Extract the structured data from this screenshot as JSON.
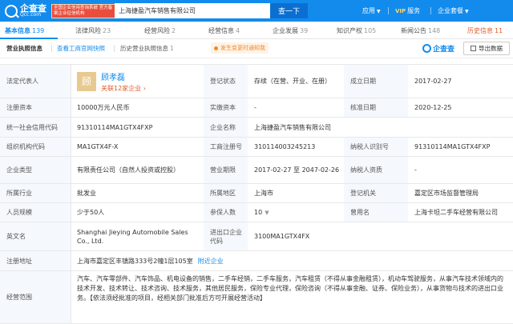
{
  "header": {
    "logo_cn": "企查查",
    "logo_en": "Qcc.com",
    "auth_badge": "全国企业信用查询系统 官方备案企业征信机构",
    "search_value": "上海捷盈汽车销售有限公司",
    "search_button": "查一下",
    "nav_app": "应用",
    "nav_vip_tag": "VIP",
    "nav_vip": "服务",
    "nav_group": "企业套餐"
  },
  "tabs": [
    {
      "label": "基本信息",
      "num": "139"
    },
    {
      "label": "法律风险",
      "num": "23"
    },
    {
      "label": "经营风险",
      "num": "2"
    },
    {
      "label": "经营信息",
      "num": "4"
    },
    {
      "label": "企业发展",
      "num": "39"
    },
    {
      "label": "知识产权",
      "num": "105"
    },
    {
      "label": "新闻公告",
      "num": "148"
    },
    {
      "label": "历史信息",
      "num": "11"
    }
  ],
  "subtabs": {
    "license": "营业执照信息",
    "official": "查看工商官网快照",
    "history": "历史营业执照信息",
    "history_num": "1",
    "change_tag": "发生变更时通知我",
    "brand": "企查查",
    "export": "导出数据"
  },
  "info": {
    "legal_rep_label": "法定代表人",
    "legal_rep_avatar": "顾",
    "legal_rep_name": "顾孝磊",
    "legal_rep_assoc": "关联12家企业 ›",
    "reg_status_label": "登记状态",
    "reg_status": "存续（在营、开业、在册）",
    "founded_label": "成立日期",
    "founded": "2017-02-27",
    "reg_capital_label": "注册资本",
    "reg_capital": "10000万元人民币",
    "paid_capital_label": "实缴资本",
    "paid_capital": "-",
    "approval_label": "核准日期",
    "approval": "2020-12-25",
    "credit_code_label": "统一社会信用代码",
    "credit_code": "91310114MA1GTX4FXP",
    "company_name_label": "企业名称",
    "company_name": "上海捷盈汽车销售有限公司",
    "org_code_label": "组织机构代码",
    "org_code": "MA1GTX4F-X",
    "biz_reg_label": "工商注册号",
    "biz_reg": "310114003245213",
    "taxpayer_id_label": "纳税人识别号",
    "taxpayer_id": "91310114MA1GTX4FXP",
    "type_label": "企业类型",
    "type": "有限责任公司（自然人投资或控股）",
    "term_label": "营业期限",
    "term": "2017-02-27 至 2047-02-26",
    "taxpayer_qual_label": "纳税人资质",
    "taxpayer_qual": "-",
    "industry_label": "所属行业",
    "industry": "批发业",
    "region_label": "所属地区",
    "region": "上海市",
    "authority_label": "登记机关",
    "authority": "嘉定区市场监督管理局",
    "staff_label": "人员规模",
    "staff": "少于50人",
    "insured_label": "参保人数",
    "insured": "10",
    "former_label": "曾用名",
    "former": "上海卡坦二手车经营有限公司",
    "en_name_label": "英文名",
    "en_name": "Shanghai Jieying Automobile Sales Co., Ltd.",
    "ie_code_label": "进出口企业代码",
    "ie_code": "3100MA1GTX4FX",
    "address_label": "注册地址",
    "address": "上海市嘉定区丰镇路333号2幢1层105室",
    "nearby": "附近企业",
    "scope_label": "经营范围",
    "scope": "汽车、汽车零部件、汽车饰品、机电设备的销售，二手车经销，二手车服务，汽车租赁（不得从事金融租赁），机动车驾驶服务，从事汽车技术领域内的技术开发、技术转让、技术咨询、技术服务，其他居民服务，保险专业代理，保险咨询（不得从事金融、证券、保险业务），从事货物与技术的进出口业务。【依法须经批准的项目，经相关部门批准后方可开展经营活动】"
  }
}
